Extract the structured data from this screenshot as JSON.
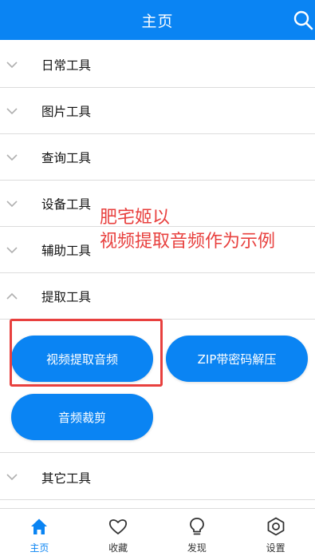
{
  "header": {
    "title": "主页"
  },
  "sections": [
    {
      "label": "日常工具",
      "state": "collapsed"
    },
    {
      "label": "图片工具",
      "state": "collapsed"
    },
    {
      "label": "查询工具",
      "state": "collapsed"
    },
    {
      "label": "设备工具",
      "state": "collapsed"
    },
    {
      "label": "辅助工具",
      "state": "collapsed"
    },
    {
      "label": "提取工具",
      "state": "expanded"
    }
  ],
  "extract_tools": [
    "视频提取音频",
    "ZIP带密码解压",
    "音频裁剪"
  ],
  "other_section": {
    "label": "其它工具",
    "state": "collapsed"
  },
  "annotation": {
    "line1": "肥宅姬以",
    "line2": "视频提取音频作为示例",
    "color": "#e8403e"
  },
  "tabs": [
    {
      "label": "主页",
      "icon": "home-icon",
      "active": true
    },
    {
      "label": "收藏",
      "icon": "heart-icon",
      "active": false
    },
    {
      "label": "发现",
      "icon": "bulb-icon",
      "active": false
    },
    {
      "label": "设置",
      "icon": "gear-icon",
      "active": false
    }
  ],
  "colors": {
    "accent": "#0a84f3",
    "annotation": "#e8403e"
  }
}
